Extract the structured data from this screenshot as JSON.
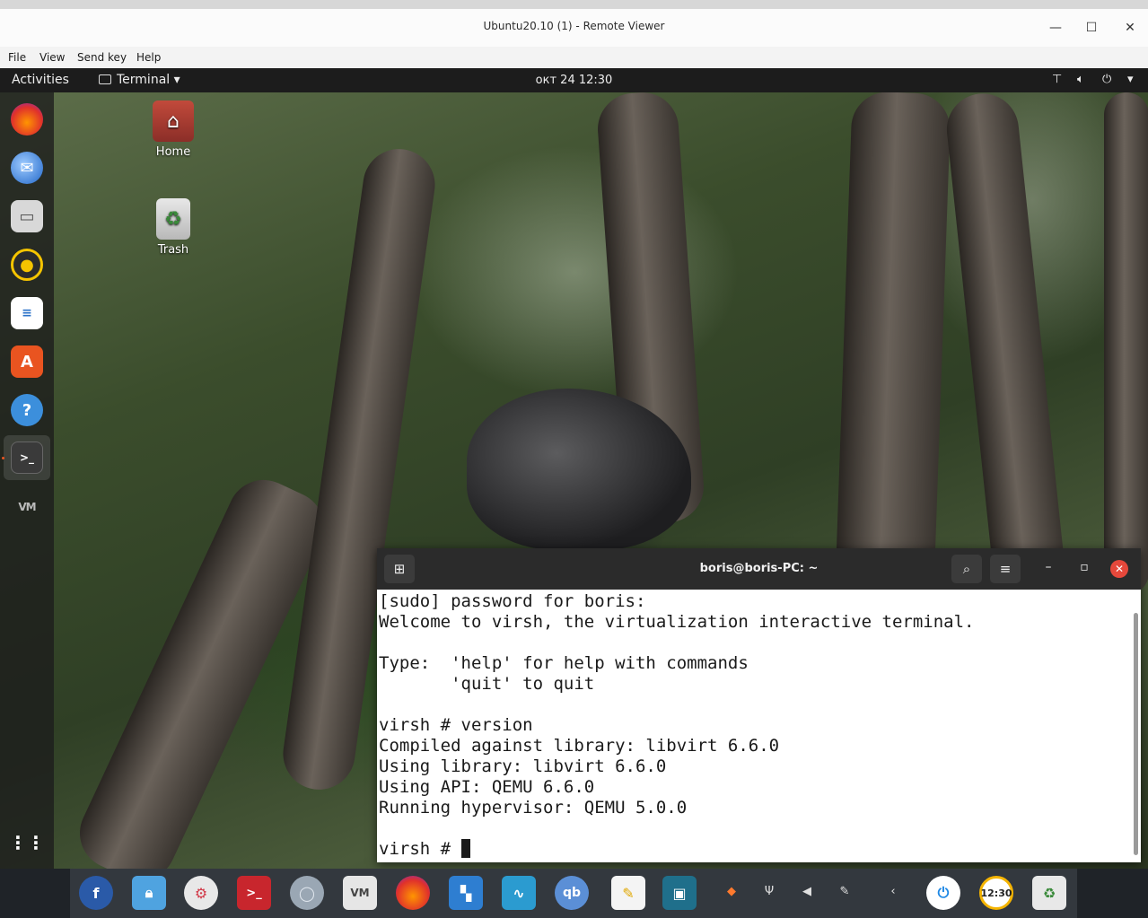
{
  "window": {
    "title": "Ubuntu20.10 (1) - Remote Viewer",
    "controls": {
      "minimize": "—",
      "maximize": "☐",
      "close": "✕"
    }
  },
  "menu": [
    "File",
    "View",
    "Send key",
    "Help"
  ],
  "topbar": {
    "activities": "Activities",
    "app_menu": "Terminal ▾",
    "clock": "окт 24  12:30",
    "icons": [
      "network-icon",
      "volume-icon",
      "power-icon",
      "dropdown-icon"
    ]
  },
  "dock": {
    "items": [
      "firefox",
      "thunderbird",
      "files",
      "rhythmbox",
      "libreoffice-writer",
      "ubuntu-software",
      "help",
      "terminal",
      "virt-manager",
      "show-applications"
    ]
  },
  "desktop": {
    "icons": [
      {
        "label": "Home"
      },
      {
        "label": "Trash"
      }
    ]
  },
  "terminal": {
    "title": "boris@boris-PC: ~",
    "lines": [
      "[sudo] password for boris:",
      "Welcome to virsh, the virtualization interactive terminal.",
      "",
      "Type:  'help' for help with commands",
      "       'quit' to quit",
      "",
      "virsh # version",
      "Compiled against library: libvirt 6.6.0",
      "Using library: libvirt 6.6.0",
      "Using API: QEMU 6.6.0",
      "Running hypervisor: QEMU 5.0.0",
      ""
    ],
    "prompt": "virsh # "
  },
  "taskbar": {
    "apps": [
      "fedora",
      "keepass",
      "settings",
      "terminal",
      "circle-app",
      "virt-manager",
      "firefox",
      "mailspring",
      "system-monitor",
      "qbittorrent",
      "notes",
      "remote-viewer"
    ],
    "tray": [
      "box-icon",
      "usb-icon",
      "volume-icon",
      "pen-icon",
      "chevron-left-icon"
    ],
    "clock_text": "12:30"
  }
}
